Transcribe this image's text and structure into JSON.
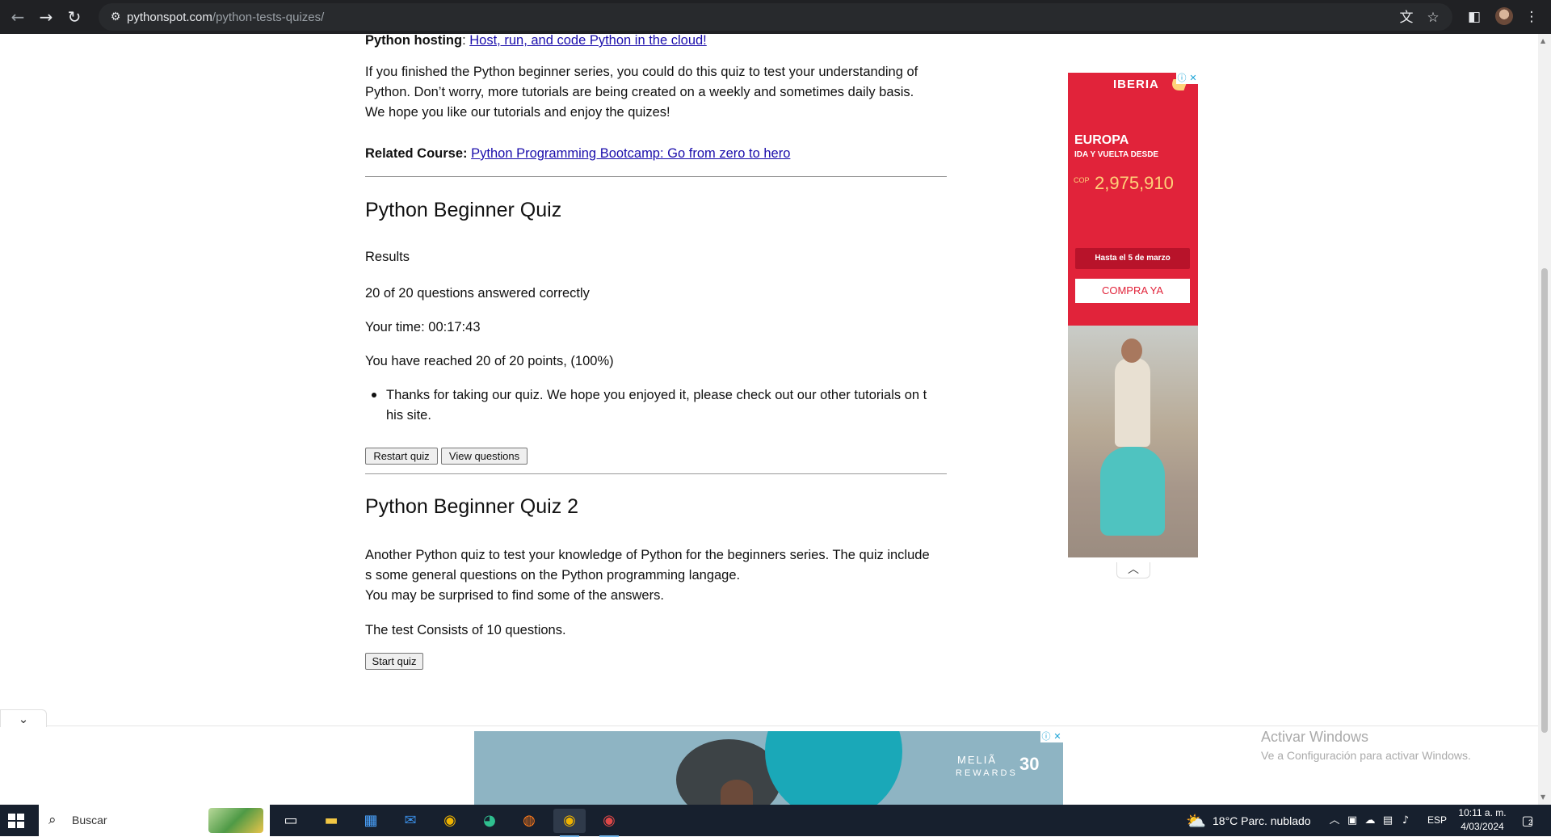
{
  "browser": {
    "url_domain": "pythonspot.com",
    "url_path": "/python-tests-quizes/"
  },
  "article": {
    "hosting_label": "Python hosting",
    "hosting_sep": ": ",
    "hosting_link": "Host, run, and code Python in the cloud!",
    "intro_line1": "If you finished the Python beginner series, you could do this quiz to test your understanding of",
    "intro_line2": "Python. Don’t worry, more tutorials are being created on a weekly and sometimes daily basis.",
    "intro_line3": "We hope you like our tutorials and enjoy the quizes!",
    "related_label": "Related Course:",
    "related_link": "Python Programming Bootcamp: Go from zero to hero",
    "quiz1": {
      "title": "Python Beginner Quiz",
      "results_label": "Results",
      "answered": "20 of 20 questions answered correctly",
      "time": "Your time: 00:17:43",
      "points": "You have reached 20 of 20 points, (100%)",
      "message_line1": "Thanks for taking our quiz. We hope you enjoyed it, please check out our other tutorials on t",
      "message_line2": "his site.",
      "restart_button": "Restart quiz",
      "view_button": "View questions"
    },
    "quiz2": {
      "title": "Python Beginner Quiz 2",
      "desc_line1": "Another Python quiz to test your knowledge of Python for the beginners series. The quiz include",
      "desc_line2": "s some general questions on the Python programming langage.",
      "desc_line3": "You may be surprised to find some of the answers.",
      "count": "The test Consists of 10 questions.",
      "start_button": "Start quiz"
    }
  },
  "ad_side": {
    "brand": "IBERIA",
    "headline": "EUROPA",
    "subline": "IDA Y VUELTA DESDE",
    "currency": "COP",
    "price": "2,975,910",
    "deadline": "Hasta el 5 de marzo",
    "cta": "COMPRA YA"
  },
  "ad_bottom": {
    "brand": "MELIÃ",
    "sub": "REWARDS",
    "badge": "30"
  },
  "watermark": {
    "title": "Activar Windows",
    "subtitle": "Ve a Configuración para activar Windows."
  },
  "taskbar": {
    "search_placeholder": "Buscar",
    "weather": "18°C  Parc. nublado",
    "language": "ESP",
    "time": "10:11 a. m.",
    "date": "4/03/2024",
    "notifications": "2"
  },
  "colors": {
    "link": "#1a0dab",
    "ad_red": "#e1233a",
    "ad_gold": "#ffd27a"
  }
}
